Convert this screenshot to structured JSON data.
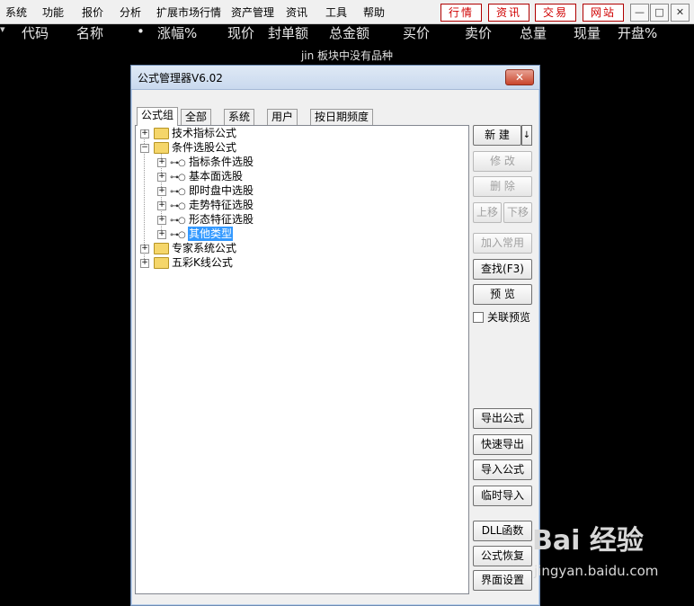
{
  "menu": [
    "系统",
    "功能",
    "报价",
    "分析",
    "扩展市场行情",
    "资产管理",
    "资讯",
    "工具",
    "帮助"
  ],
  "red_buttons": [
    "行情",
    "资讯",
    "交易",
    "网站"
  ],
  "window_controls": {
    "minimize": "—",
    "restore": "□",
    "close": "✕"
  },
  "quote_header": [
    "代码",
    "名称",
    "•",
    "涨幅%",
    "现价",
    "封单额",
    "总金额",
    "买价",
    "卖价",
    "总量",
    "现量",
    "开盘%"
  ],
  "status_message": "jin 板块中没有品种",
  "dialog": {
    "title": "公式管理器V6.02",
    "close": "✕",
    "tabs": [
      "公式组",
      "全部",
      "系统",
      "用户",
      "按日期频度"
    ],
    "tree": [
      {
        "label": "技术指标公式",
        "level": 0,
        "expander": "+",
        "icon": "folder"
      },
      {
        "label": "条件选股公式",
        "level": 0,
        "expander": "−",
        "icon": "folder"
      },
      {
        "label": "指标条件选股",
        "level": 1,
        "expander": "+",
        "icon": "key"
      },
      {
        "label": "基本面选股",
        "level": 1,
        "expander": "+",
        "icon": "key"
      },
      {
        "label": "即时盘中选股",
        "level": 1,
        "expander": "+",
        "icon": "key"
      },
      {
        "label": "走势特征选股",
        "level": 1,
        "expander": "+",
        "icon": "key"
      },
      {
        "label": "形态特征选股",
        "level": 1,
        "expander": "+",
        "icon": "key"
      },
      {
        "label": "其他类型",
        "level": 1,
        "expander": "+",
        "icon": "key",
        "selected": true
      },
      {
        "label": "专家系统公式",
        "level": 0,
        "expander": "+",
        "icon": "folder"
      },
      {
        "label": "五彩K线公式",
        "level": 0,
        "expander": "+",
        "icon": "folder"
      }
    ],
    "buttons": {
      "new": "新 建",
      "new_arrow": "↓",
      "modify": "修 改",
      "delete": "删 除",
      "move_up": "上移",
      "move_down": "下移",
      "add_common": "加入常用",
      "find": "查找(F3)",
      "preview": "预 览",
      "assoc_preview": "关联预览",
      "export": "导出公式",
      "quick_export": "快速导出",
      "import": "导入公式",
      "temp_import": "临时导入",
      "dll": "DLL函数",
      "restore": "公式恢复",
      "ui_settings": "界面设置"
    }
  },
  "watermark": {
    "logo": "Bai 经验",
    "url": "jingyan.baidu.com"
  }
}
